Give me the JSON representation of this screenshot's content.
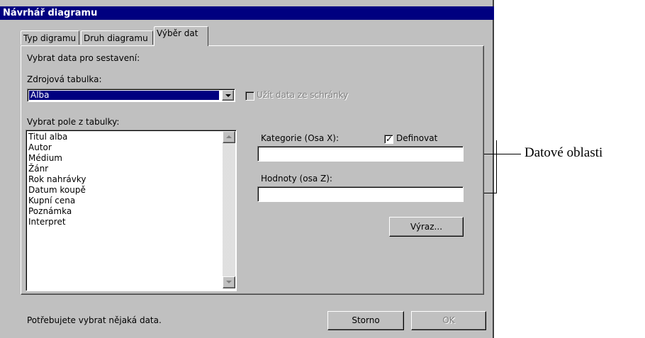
{
  "window": {
    "title": "Návrhář diagramu"
  },
  "tabs": [
    {
      "label": "Typ digramu",
      "active": false
    },
    {
      "label": "Druh diagramu",
      "active": false
    },
    {
      "label": "Výběr dat",
      "active": true
    }
  ],
  "data_selection": {
    "heading": "Vybrat data pro sestavení:",
    "source_table_label": "Zdrojová tabulka:",
    "source_table_value": "Alba",
    "clipboard_checkbox": {
      "label": "Užít data ze schránky",
      "checked": false,
      "enabled": false
    },
    "fields_label": "Vybrat pole z tabulky:",
    "fields": [
      "Titul alba",
      "Autor",
      "Médium",
      "Žánr",
      "Rok nahrávky",
      "Datum koupě",
      "Kupní cena",
      "Poznámka",
      "Interpret"
    ]
  },
  "data_areas": {
    "category_label": "Kategorie (Osa X):",
    "define_checkbox": {
      "label": "Definovat",
      "checked": true
    },
    "category_value": "",
    "values_label": "Hodnoty (osa Z):",
    "values_value": "",
    "expression_button": "Výraz..."
  },
  "footer": {
    "status": "Potřebujete vybrat nějaká data.",
    "cancel_button": "Storno",
    "ok_button": "OK",
    "ok_enabled": false
  },
  "annotation": {
    "text": "Datové oblasti"
  },
  "colors": {
    "titlebar": "#000080",
    "face": "#c0c0c0",
    "selection": "#000080"
  },
  "icons": [
    "dropdown-arrow-icon",
    "scroll-up-arrow-icon",
    "scroll-down-arrow-icon",
    "checkmark-icon"
  ]
}
